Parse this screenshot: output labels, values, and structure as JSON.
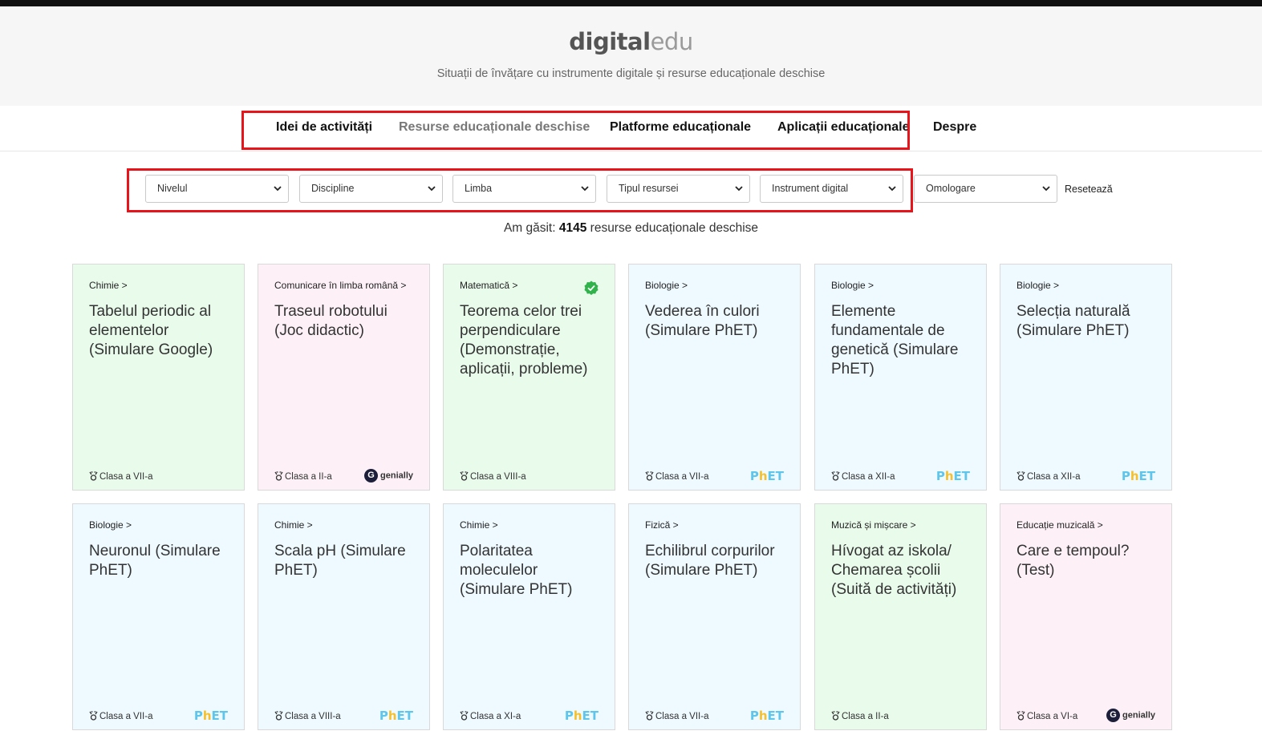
{
  "brand": {
    "bold": "digital",
    "light": "edu"
  },
  "tagline": "Situații de învățare cu instrumente digitale și resurse educaționale deschise",
  "nav": [
    {
      "label": "Idei de activități"
    },
    {
      "label": "Resurse educaționale deschise"
    },
    {
      "label": "Platforme educaționale"
    },
    {
      "label": "Aplicații educaționale"
    },
    {
      "label": "Despre"
    }
  ],
  "filters": [
    {
      "value": "Nivelul"
    },
    {
      "value": "Discipline"
    },
    {
      "value": "Limba"
    },
    {
      "value": "Tipul resursei"
    },
    {
      "value": "Instrument digital"
    },
    {
      "value": "Omologare"
    }
  ],
  "reset_label": "Resetează",
  "results": {
    "prefix": "Am găsit:",
    "count": "4145",
    "suffix": "resurse educaționale deschise"
  },
  "colors": {
    "highlight_box": "#e8141b",
    "green_card": "#e9fbeb",
    "pink_card": "#fdf1f7",
    "blue_card": "#eefaff",
    "verified": "#2fb34a"
  },
  "cards": [
    {
      "category": "Chimie >",
      "title": "Tabelul periodic al elementelor (Simulare Google)",
      "grade": "Clasa a VII-a",
      "badge": ""
    },
    {
      "category": "Comunicare în limba română >",
      "title": "Traseul robotului (Joc didactic)",
      "grade": "Clasa a II-a",
      "badge": "genially"
    },
    {
      "category": "Matematică >",
      "title": "Teorema celor trei perpendiculare (Demonstrație, aplicații, probleme)",
      "grade": "Clasa a VIII-a",
      "badge": ""
    },
    {
      "category": "Biologie >",
      "title": "Vederea în culori (Simulare PhET)",
      "grade": "Clasa a VII-a",
      "badge": "PhET"
    },
    {
      "category": "Biologie >",
      "title": "Elemente fundamentale de genetică (Simulare PhET)",
      "grade": "Clasa a XII-a",
      "badge": "PhET"
    },
    {
      "category": "Biologie >",
      "title": "Selecția naturală (Simulare PhET)",
      "grade": "Clasa a XII-a",
      "badge": "PhET"
    },
    {
      "category": "Biologie >",
      "title": "Neuronul (Simulare PhET)",
      "grade": "Clasa a VII-a",
      "badge": "PhET"
    },
    {
      "category": "Chimie >",
      "title": "Scala pH (Simulare PhET)",
      "grade": "Clasa a VIII-a",
      "badge": "PhET"
    },
    {
      "category": "Chimie >",
      "title": "Polaritatea moleculelor (Simulare PhET)",
      "grade": "Clasa a XI-a",
      "badge": "PhET"
    },
    {
      "category": "Fizică >",
      "title": "Echilibrul corpurilor (Simulare PhET)",
      "grade": "Clasa a VII-a",
      "badge": "PhET"
    },
    {
      "category": "Muzică și mișcare >",
      "title": "Hívogat az iskola/ Chemarea școlii (Suită de activități)",
      "grade": "Clasa a II-a",
      "badge": ""
    },
    {
      "category": "Educație muzicală >",
      "title": "Care e tempoul? (Test)",
      "grade": "Clasa a VI-a",
      "badge": "genially"
    }
  ]
}
